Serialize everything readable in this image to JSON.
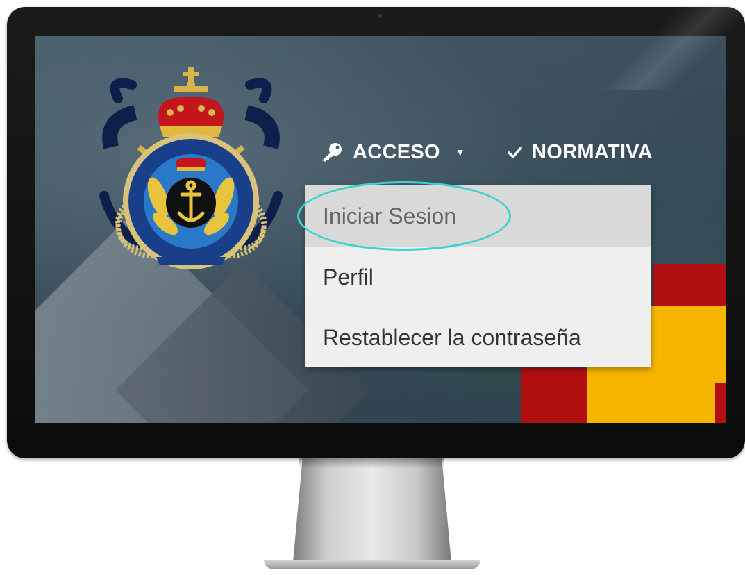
{
  "nav": {
    "acceso_label": "ACCESO",
    "normativa_label": "NORMATIVA",
    "icons": {
      "acceso": "key-icon",
      "acceso_caret": "caret-down-icon",
      "normativa": "check-icon"
    }
  },
  "dropdown": {
    "items": [
      {
        "label": "Iniciar Sesion",
        "state": "hover"
      },
      {
        "label": "Perfil"
      },
      {
        "label": "Restablecer la contraseña"
      }
    ]
  },
  "emblem": {
    "name": "club-emblem-logo",
    "text_ring": "CENTRO DEPORTIVO Y SOCIOCULTURAL DE OFICIALES DE LA ARMADA",
    "ribbon_text": "CARTAGENA"
  },
  "colors": {
    "highlight": "#3fd3cf",
    "flag_red": "#b10f10",
    "flag_yellow": "#f7b500",
    "dropdown_bg": "#efefef"
  }
}
